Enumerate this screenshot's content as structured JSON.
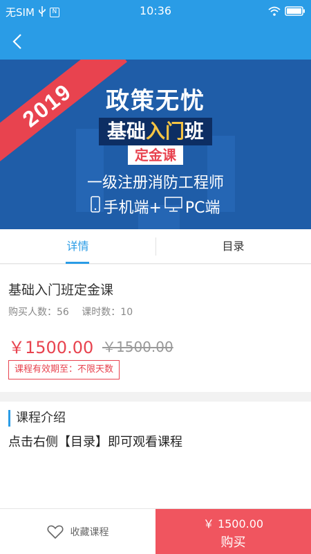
{
  "status_bar": {
    "carrier": "无SIM",
    "time": "10:36",
    "nfc": "N"
  },
  "banner": {
    "ribbon_year": "2019",
    "title": "政策无忧",
    "course_line1_a": "基础",
    "course_line1_b": "入门",
    "course_line1_c": "班",
    "course_line2": "定金课",
    "subtitle": "一级注册消防工程师",
    "devices_mobile": "手机端+",
    "devices_pc": "PC端"
  },
  "tabs": [
    {
      "label": "详情",
      "active": true
    },
    {
      "label": "目录",
      "active": false
    }
  ],
  "course": {
    "title": "基础入门班定金课",
    "buyers_label": "购买人数：56",
    "hours_label": "课时数：10",
    "price": "￥1500.00",
    "original_price": "￥1500.00",
    "validity": "课程有效期至：不限天数"
  },
  "intro": {
    "heading": "课程介绍",
    "text": "点击右侧【目录】即可观看课程"
  },
  "bottom": {
    "favorite_label": "收藏课程",
    "buy_price": "￥ 1500.00",
    "buy_label": "购买"
  },
  "colors": {
    "primary": "#2a9ce6",
    "accent": "#e8434f",
    "buy": "#f0555f"
  }
}
